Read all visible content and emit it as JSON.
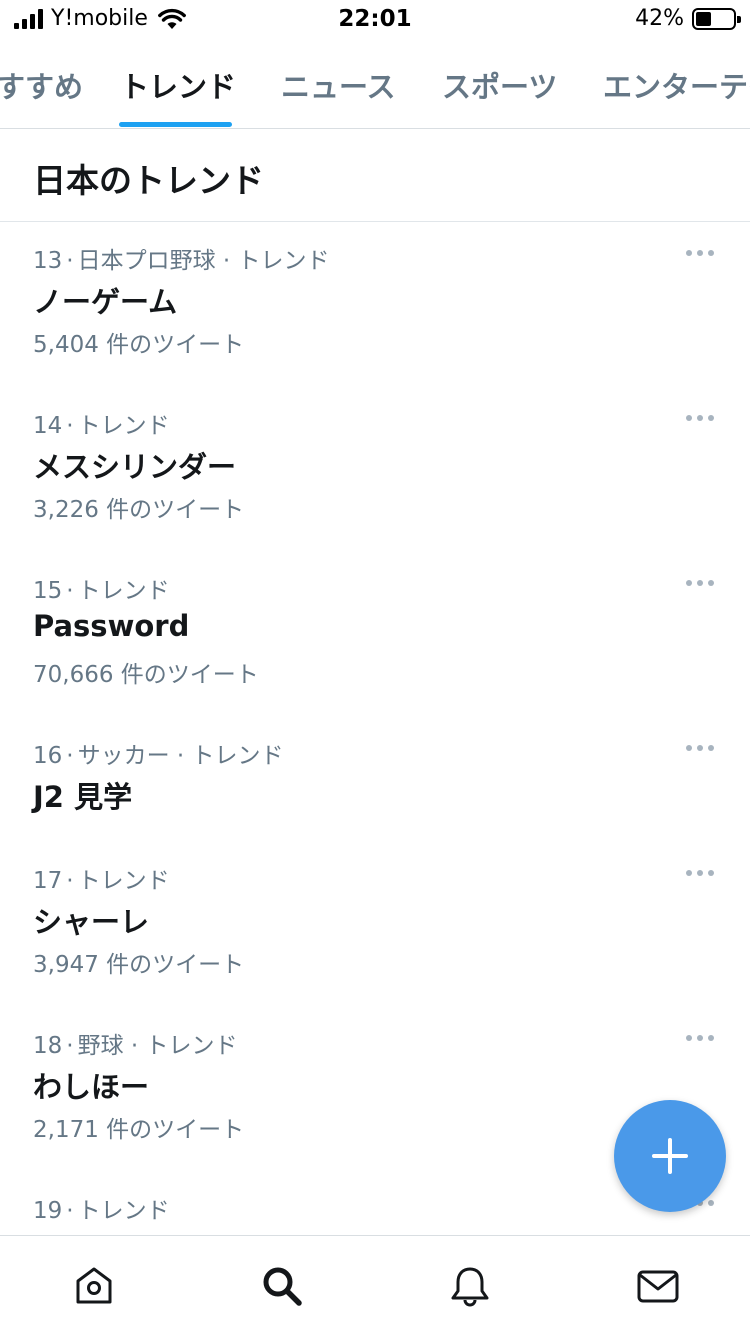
{
  "status_bar": {
    "carrier": "Y!mobile",
    "time": "22:01",
    "battery_percent": "42%",
    "battery_level": 0.42,
    "signal_icon": "signal-bars-icon",
    "wifi_icon": "wifi-icon"
  },
  "tabs": [
    {
      "label": "すすめ",
      "active": false
    },
    {
      "label": "トレンド",
      "active": true
    },
    {
      "label": "ニュース",
      "active": false
    },
    {
      "label": "スポーツ",
      "active": false
    },
    {
      "label": "エンターテイ",
      "active": false
    }
  ],
  "section": {
    "title": "日本のトレンド"
  },
  "trends": [
    {
      "rank": "13",
      "category": "日本プロ野球 · トレンド",
      "name": "ノーゲーム",
      "count": "5,404 件のツイート"
    },
    {
      "rank": "14",
      "category": "トレンド",
      "name": "メスシリンダー",
      "count": "3,226 件のツイート"
    },
    {
      "rank": "15",
      "category": "トレンド",
      "name": "Password",
      "count": "70,666 件のツイート"
    },
    {
      "rank": "16",
      "category": "サッカー · トレンド",
      "name": "J2 見学",
      "count": ""
    },
    {
      "rank": "17",
      "category": "トレンド",
      "name": "シャーレ",
      "count": "3,947 件のツイート"
    },
    {
      "rank": "18",
      "category": "野球 · トレンド",
      "name": "わしほー",
      "count": "2,171 件のツイート"
    },
    {
      "rank": "19",
      "category": "トレンド",
      "name": "",
      "count": ""
    }
  ],
  "fab": {
    "icon": "plus-icon"
  },
  "bottom_nav": [
    {
      "name": "home",
      "icon": "home-icon",
      "active": false
    },
    {
      "name": "search",
      "icon": "search-icon",
      "active": true
    },
    {
      "name": "notifications",
      "icon": "bell-icon",
      "active": false
    },
    {
      "name": "messages",
      "icon": "mail-icon",
      "active": false
    }
  ],
  "colors": {
    "accent": "#1da1f2",
    "fab": "#4a99e9",
    "secondary_text": "#657786"
  }
}
